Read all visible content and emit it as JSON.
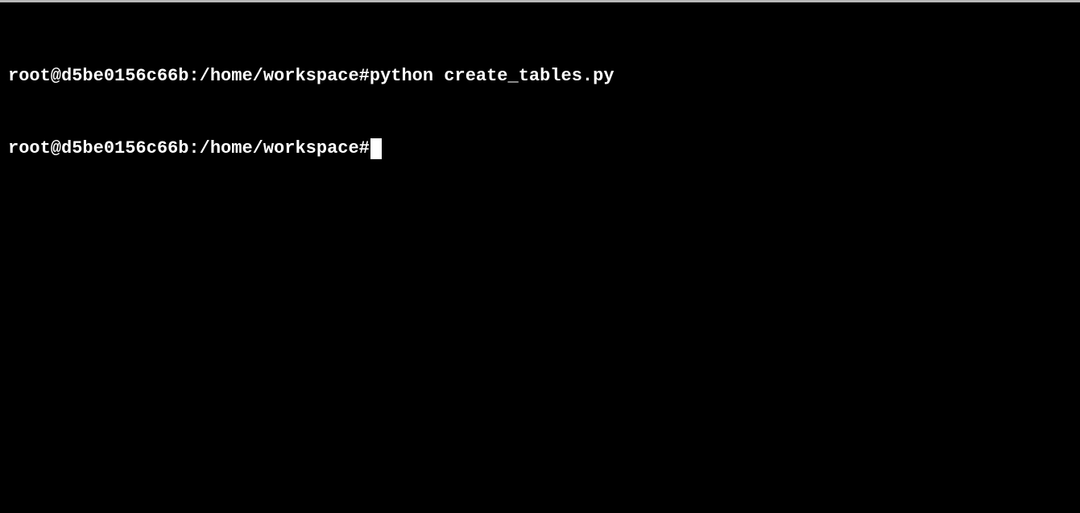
{
  "terminal": {
    "lines": [
      {
        "prompt": "root@d5be0156c66b:/home/workspace#",
        "command": "python create_tables.py"
      },
      {
        "prompt": "root@d5be0156c66b:/home/workspace#",
        "command": ""
      }
    ]
  }
}
